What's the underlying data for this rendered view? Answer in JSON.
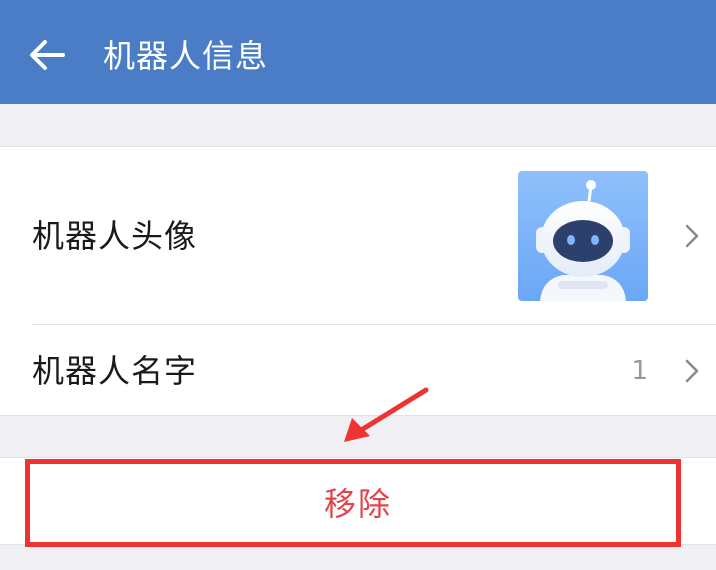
{
  "header": {
    "title": "机器人信息",
    "back_icon": "arrow-left-icon",
    "background": "#4a7dc5"
  },
  "robot_info": {
    "avatar_label": "机器人头像",
    "avatar_icon": "robot-avatar-icon",
    "name_label": "机器人名字",
    "name_value": "1"
  },
  "actions": {
    "remove_label": "移除",
    "remove_color": "#e0454a"
  },
  "annotation": {
    "highlight_color": "#ee3333"
  }
}
